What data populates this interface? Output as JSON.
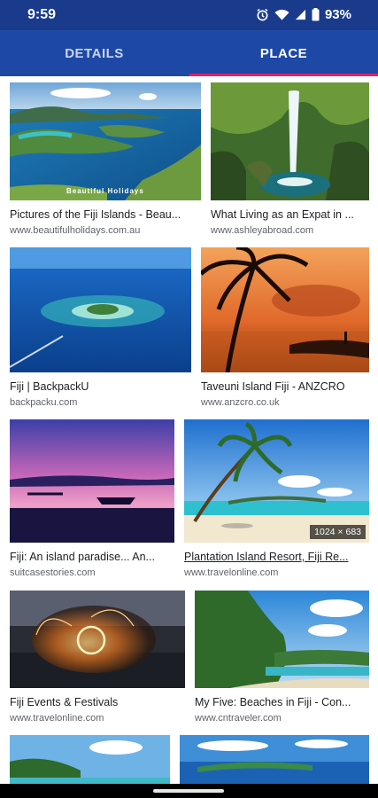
{
  "status_bar": {
    "time": "9:59",
    "battery": "93%",
    "icons": [
      "alarm-icon",
      "wifi-icon",
      "signal-icon",
      "battery-icon"
    ]
  },
  "tabs": [
    {
      "label": "DETAILS",
      "selected": false
    },
    {
      "label": "PLACE",
      "selected": true
    }
  ],
  "colors": {
    "status_bar": "#1a3a8c",
    "tab_bar": "#1e48a6",
    "indicator": "#e91e63"
  },
  "results": [
    {
      "title": "Pictures of the Fiji Islands - Beau...",
      "source": "www.beautifulholidays.com.au",
      "watermark": "Beautiful Holidays"
    },
    {
      "title": "What Living as an Expat in ...",
      "source": "www.ashleyabroad.com"
    },
    {
      "title": "Fiji | BackpackU",
      "source": "backpacku.com"
    },
    {
      "title": "Taveuni Island Fiji - ANZCRO",
      "source": "www.anzcro.co.uk"
    },
    {
      "title": "Fiji: An island paradise... An...",
      "source": "suitcasestories.com"
    },
    {
      "title": "Plantation Island Resort, Fiji Re...",
      "source": "www.travelonline.com",
      "dimensions": "1024 × 683",
      "selected": true
    },
    {
      "title": "Fiji Events & Festivals",
      "source": "www.travelonline.com"
    },
    {
      "title": "My Five: Beaches in Fiji - Con...",
      "source": "www.cntraveler.com"
    }
  ]
}
